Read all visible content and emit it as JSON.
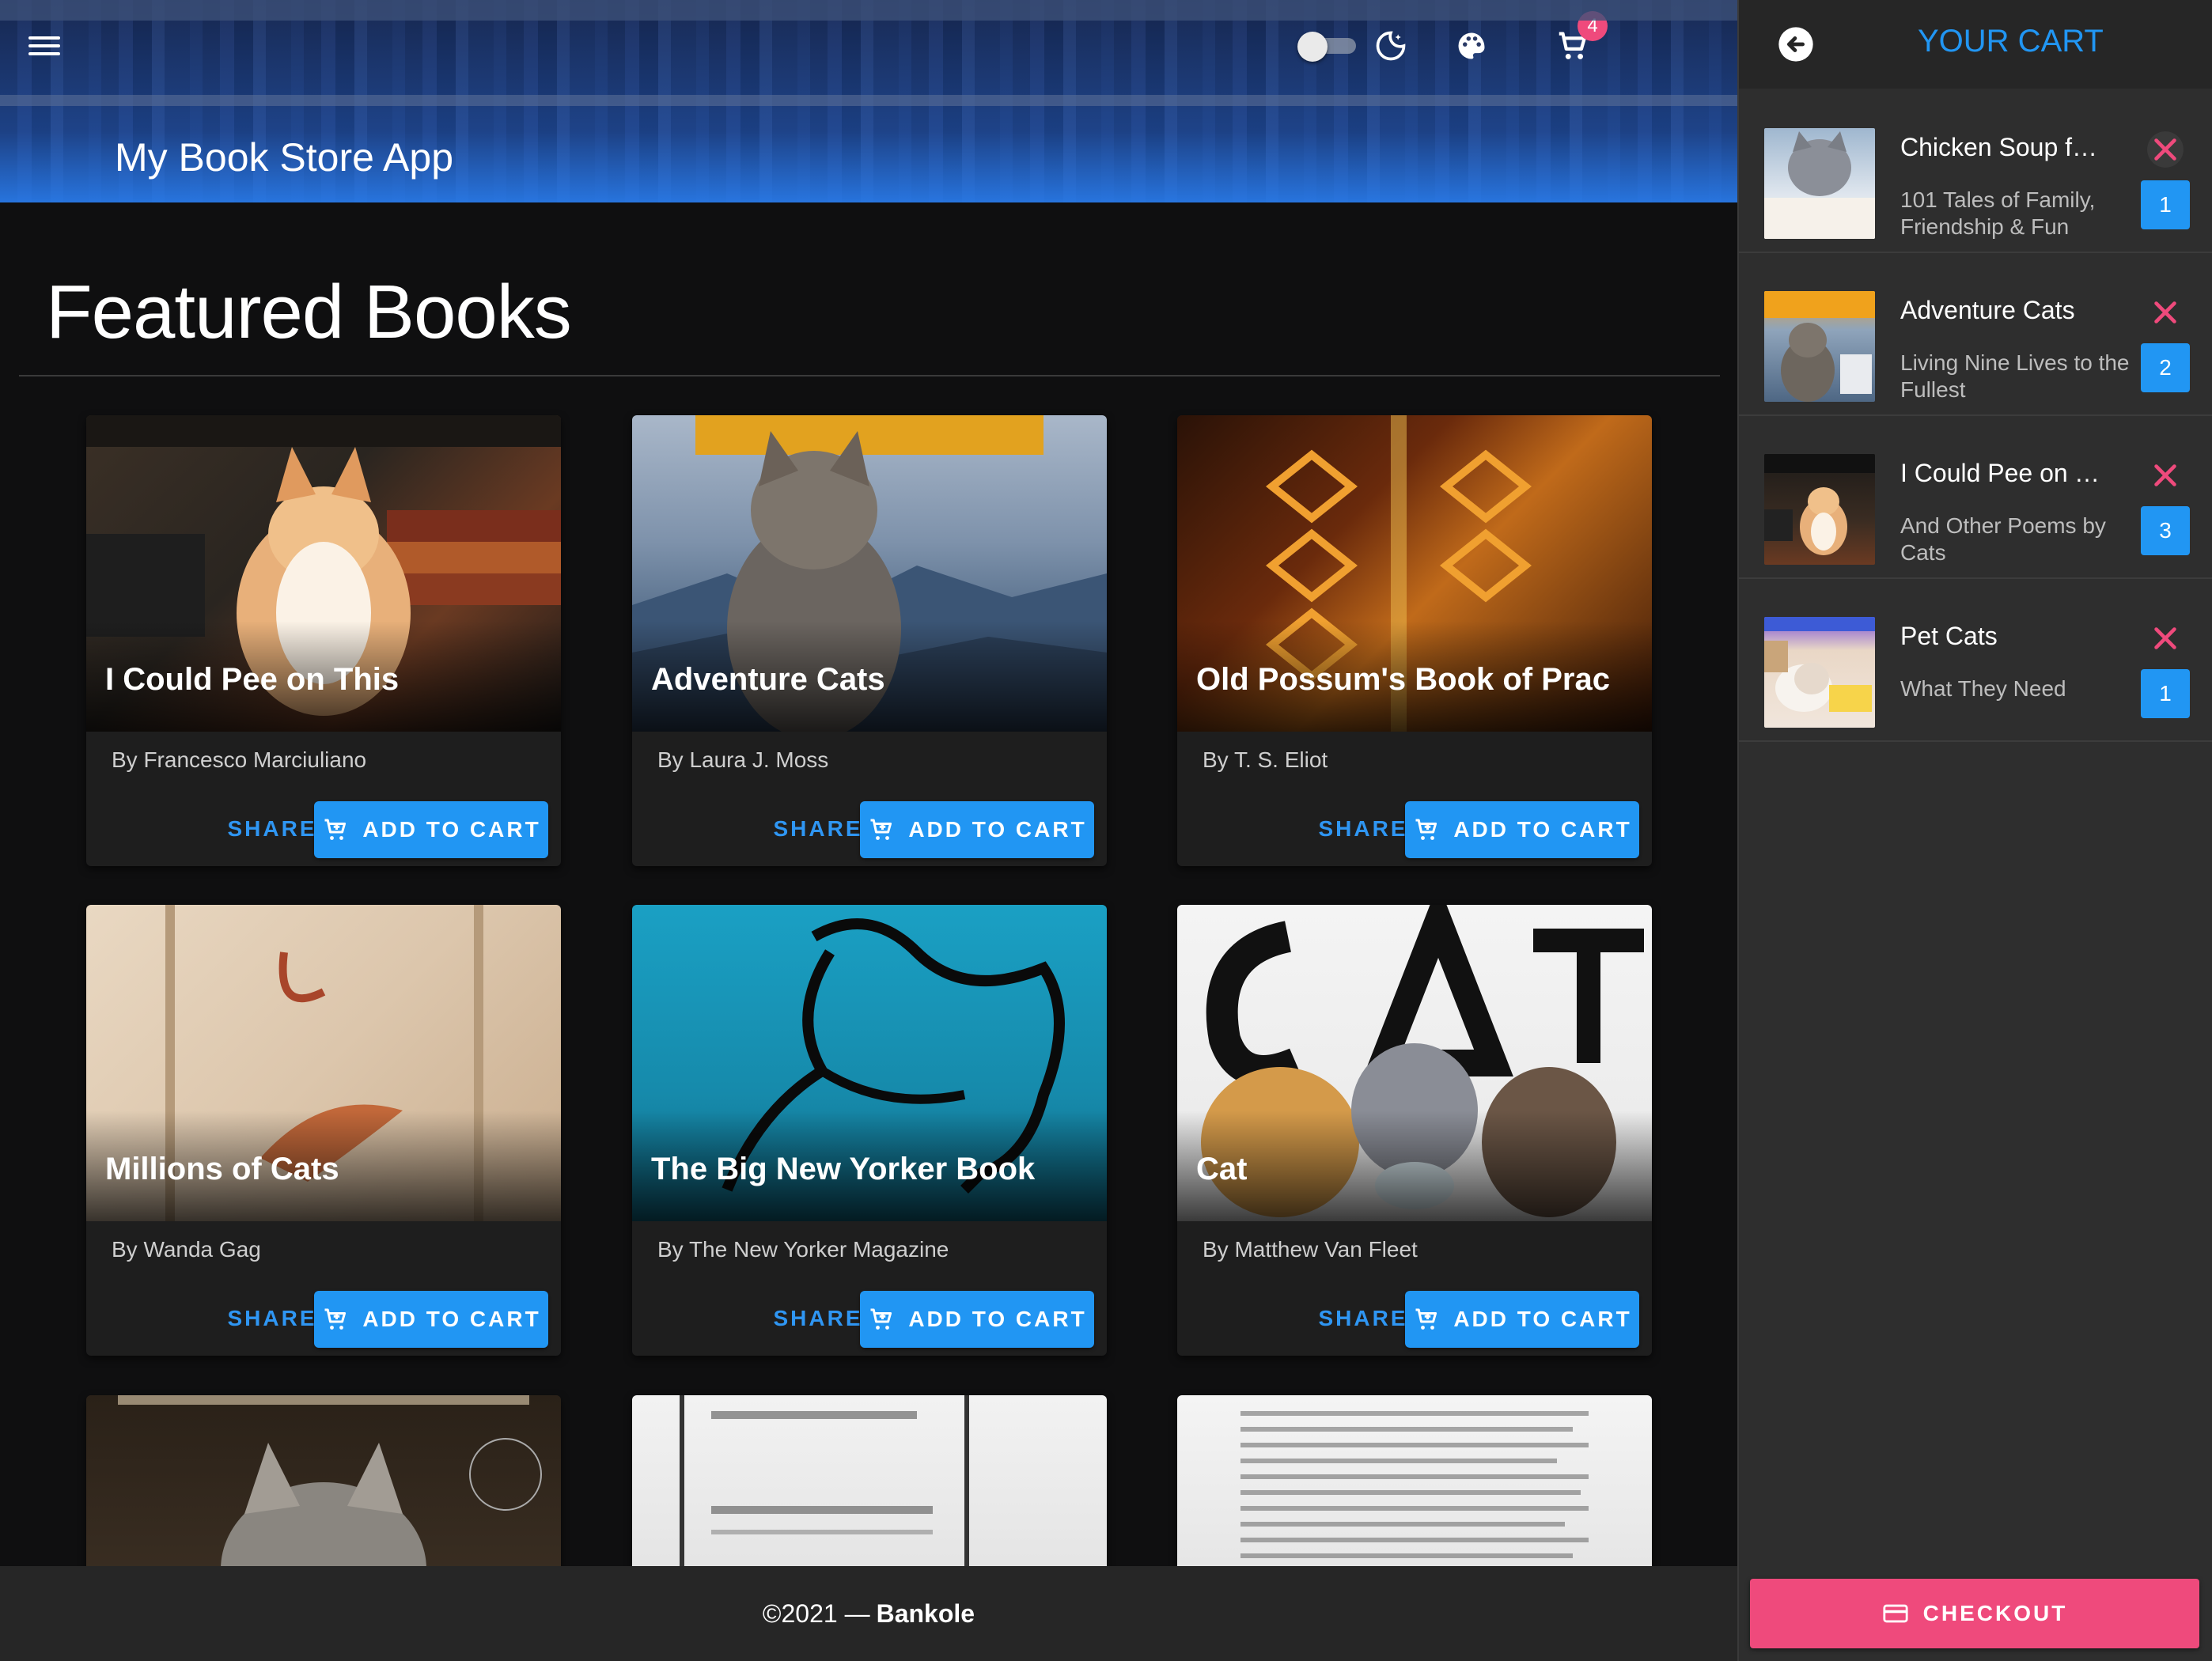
{
  "header": {
    "app_title": "My Book Store App",
    "cart_count": "4",
    "icons": [
      "menu-icon",
      "theme-toggle",
      "dark-mode-icon",
      "palette-icon",
      "cart-icon"
    ]
  },
  "main": {
    "section_title": "Featured Books",
    "share_label": "SHARE",
    "add_label": "ADD TO CART",
    "books": [
      {
        "title": "I Could Pee on This",
        "author": "By Francesco Marciuliano"
      },
      {
        "title": "Adventure Cats",
        "author": "By Laura J. Moss"
      },
      {
        "title": "Old Possum's Book of Prac",
        "author": "By T. S. Eliot"
      },
      {
        "title": "Millions of Cats",
        "author": "By Wanda Gag"
      },
      {
        "title": "The Big New Yorker Book",
        "author": "By The New Yorker Magazine"
      },
      {
        "title": "Cat",
        "author": "By Matthew Van Fleet"
      }
    ]
  },
  "footer": {
    "copyright": "©2021 —",
    "author": "Bankole"
  },
  "cart": {
    "title": "YOUR CART",
    "items": [
      {
        "name": "Chicken Soup for...",
        "subtitle": "101 Tales of Family, Friendship & Fun",
        "qty": "1"
      },
      {
        "name": "Adventure Cats",
        "subtitle": "Living Nine Lives to the Fullest",
        "qty": "2"
      },
      {
        "name": "I Could Pee on T...",
        "subtitle": "And Other Poems by Cats",
        "qty": "3"
      },
      {
        "name": "Pet Cats",
        "subtitle": "What They Need",
        "qty": "1"
      }
    ],
    "checkout_label": "CHECKOUT"
  },
  "colors": {
    "accent": "#2196f3",
    "checkout": "#ef4a7c",
    "background": "#0f0f10"
  }
}
